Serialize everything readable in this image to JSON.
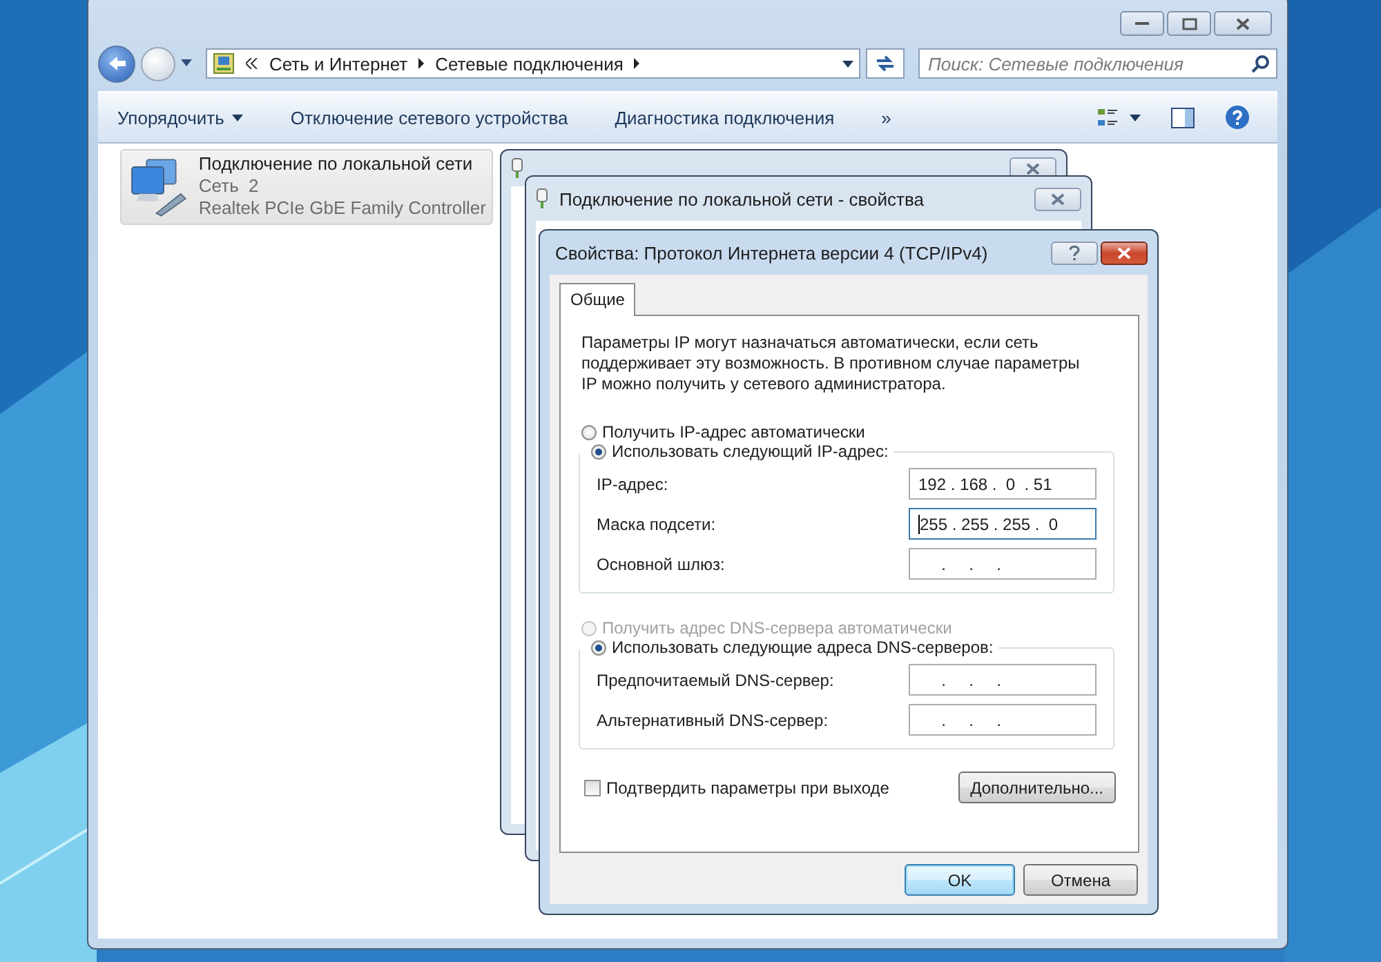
{
  "explorer": {
    "breadcrumb": [
      "Сеть и Интернет",
      "Сетевые подключения"
    ],
    "search_placeholder": "Поиск: Сетевые подключения",
    "toolbar": [
      {
        "label": "Упорядочить",
        "kind": "menu"
      },
      {
        "label": "Отключение сетевого устройства",
        "kind": "command"
      },
      {
        "label": "Диагностика подключения",
        "kind": "command"
      },
      {
        "label": "»",
        "kind": "more"
      }
    ],
    "connections": [
      {
        "name": "Подключение по локальной сети",
        "network": "Сеть  2",
        "adapter": "Realtek PCIe GbE Family Controller",
        "selected": true
      }
    ]
  },
  "middle_dialog": {
    "title": "Подключение по локальной сети - свойства"
  },
  "dialog": {
    "title": "Свойства: Протокол Интернета версии 4 (TCP/IPv4)",
    "tabs": [
      {
        "label": "Общие",
        "selected": true
      }
    ],
    "description": "Параметры IP могут назначаться автоматически, если сеть поддерживает эту возможность. В противном случае параметры IP можно получить у сетевого администратора.",
    "ip_options": [
      {
        "label": "Получить IP-адрес автоматически",
        "selected": false,
        "disabled": false
      },
      {
        "label": "Использовать следующий IP-адрес:",
        "selected": true,
        "disabled": false
      }
    ],
    "ip_fields": [
      {
        "label": "IP-адрес:",
        "value": "192 . 168 .  0  . 51",
        "focused": false
      },
      {
        "label": "Маска подсети:",
        "value": "255 . 255 . 255 .  0",
        "focused": true
      },
      {
        "label": "Основной шлюз:",
        "value": "     .     .     .",
        "focused": false
      }
    ],
    "dns_options": [
      {
        "label": "Получить адрес DNS-сервера автоматически",
        "selected": false,
        "disabled": true
      },
      {
        "label": "Использовать следующие адреса DNS-серверов:",
        "selected": true,
        "disabled": false
      }
    ],
    "dns_fields": [
      {
        "label": "Предпочитаемый DNS-сервер:",
        "value": "     .     .     .",
        "focused": false
      },
      {
        "label": "Альтернативный DNS-сервер:",
        "value": "     .     .     .",
        "focused": false
      }
    ],
    "validate": {
      "label": "Подтвердить параметры при выходе",
      "checked": false
    },
    "advanced_button": "Дополнительно...",
    "buttons": [
      {
        "label": "OK",
        "default": true
      },
      {
        "label": "Отмена",
        "default": false
      }
    ]
  }
}
